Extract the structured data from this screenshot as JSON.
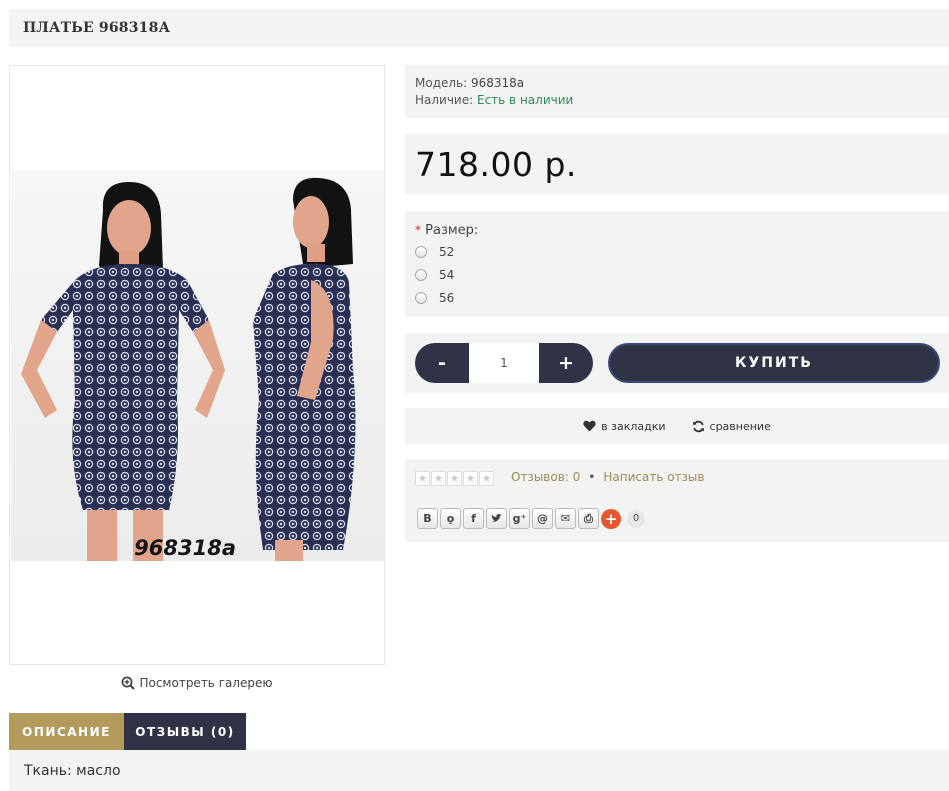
{
  "product": {
    "title": "ПЛАТЬЕ 968318А",
    "photo_code": "968318a",
    "gallery_link": "Посмотреть галерею",
    "model_label": "Модель:",
    "model_value": "968318а",
    "stock_label": "Наличие:",
    "stock_value": "Есть в наличии",
    "price": "718.00 р."
  },
  "options": {
    "required_mark": "*",
    "size_label": "Размер:",
    "sizes": [
      "52",
      "54",
      "56"
    ]
  },
  "cart": {
    "minus": "-",
    "quantity": "1",
    "plus": "+",
    "buy_label": "КУПИТЬ"
  },
  "actions": {
    "wishlist": "в закладки",
    "compare": "сравнение"
  },
  "reviews": {
    "count_text": "Отзывов: 0",
    "separator": "•",
    "write_text": "Написать отзыв",
    "rating": 0
  },
  "share": {
    "buttons": [
      "vk-icon",
      "ok-icon",
      "facebook-icon",
      "twitter-icon",
      "google-plus-icon",
      "mail-ru-icon",
      "email-icon",
      "print-icon",
      "more-plus-icon"
    ],
    "count": "0"
  },
  "tabs": {
    "description": "ОПИСАНИЕ",
    "reviews": "ОТЗЫВЫ (0)"
  },
  "description": {
    "text": "Ткань: масло"
  },
  "colors": {
    "dark": "#2f3345",
    "gold": "#b39b5e",
    "panel": "#f3f3f3",
    "in_stock": "#2e8b57"
  }
}
